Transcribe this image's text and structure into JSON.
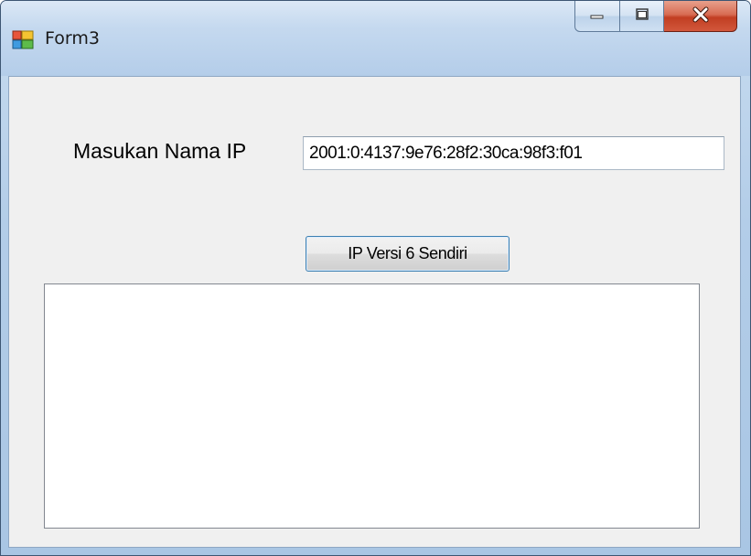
{
  "window": {
    "title": "Form3",
    "icon": "winforms-app-icon",
    "controls": {
      "minimize": "minimize-icon",
      "maximize": "maximize-icon",
      "close": "close-icon"
    },
    "colors": {
      "frame": "#b4cde9",
      "client": "#f0f0f0",
      "close_button": "#c13e22"
    }
  },
  "form": {
    "ip_label": "Masukan Nama IP",
    "ip_value": "2001:0:4137:9e76:28f2:30ca:98f3:f01",
    "button_label": "IP Versi 6 Sendiri",
    "output_text": ""
  }
}
